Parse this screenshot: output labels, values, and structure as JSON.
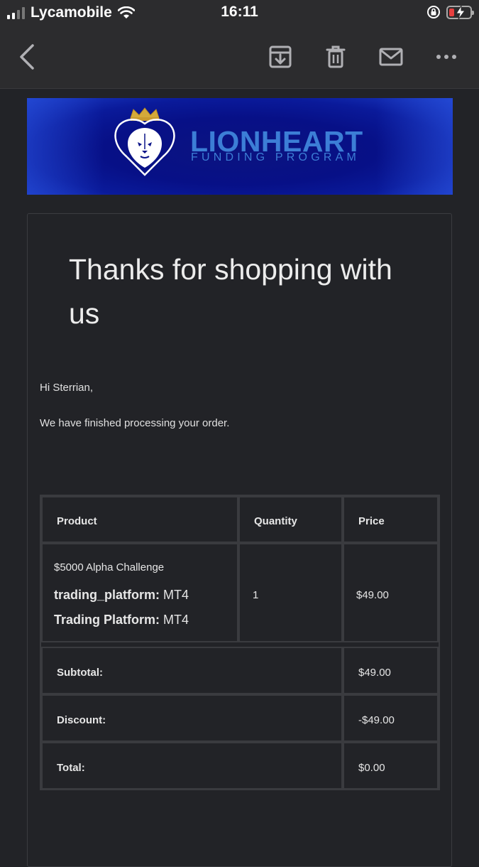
{
  "status_bar": {
    "carrier": "Lycamobile",
    "time": "16:11"
  },
  "toolbar": {
    "icons": [
      "back-chevron-icon",
      "archive-icon",
      "trash-icon",
      "mail-icon",
      "more-icon"
    ]
  },
  "banner": {
    "brand_name": "LIONHEART",
    "brand_sub": "FUNDING PROGRAM",
    "accent_color": "#3c7ed6"
  },
  "email": {
    "heading": "Thanks for shopping with us",
    "greeting": "Hi Sterrian,",
    "message": "We have finished processing your order."
  },
  "order_table": {
    "headers": {
      "product": "Product",
      "quantity": "Quantity",
      "price": "Price"
    },
    "item": {
      "name": "$5000 Alpha Challenge",
      "meta": [
        {
          "key": "trading_platform:",
          "value": "MT4"
        },
        {
          "key": "Trading Platform:",
          "value": "MT4"
        }
      ],
      "quantity": "1",
      "price": "$49.00"
    },
    "totals": [
      {
        "label": "Subtotal:",
        "value": "$49.00"
      },
      {
        "label": "Discount:",
        "value": "-$49.00"
      },
      {
        "label": "Total:",
        "value": "$0.00"
      }
    ]
  }
}
